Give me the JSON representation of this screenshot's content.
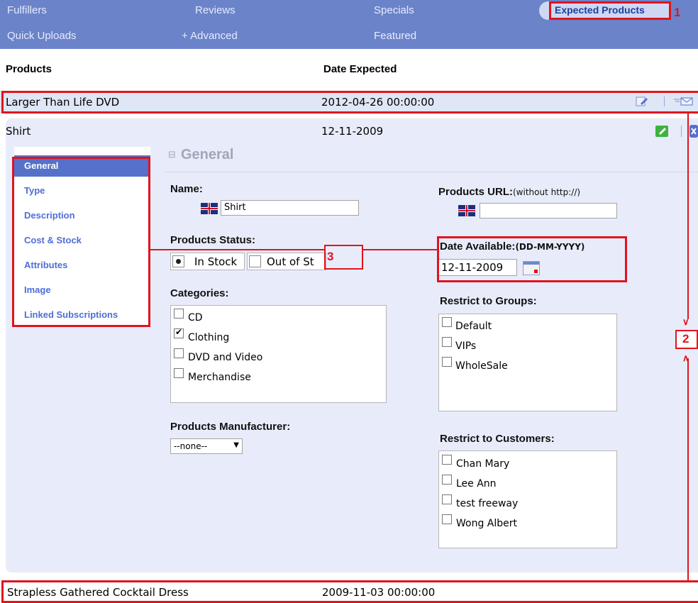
{
  "nav": {
    "row1": [
      "Fulfillers",
      "Reviews",
      "Specials"
    ],
    "row2": [
      "Quick Uploads",
      "+ Advanced",
      "Featured"
    ],
    "active_tab": "Expected Products"
  },
  "table": {
    "col_products": "Products",
    "col_date": "Date Expected",
    "rows": [
      {
        "name": "Larger Than Life DVD",
        "date": "2012-04-26 00:00:00"
      },
      {
        "name": "Shirt",
        "date": "12-11-2009"
      },
      {
        "name": "Strapless Gathered Cocktail Dress",
        "date": "2009-11-03 00:00:00"
      }
    ]
  },
  "editor": {
    "tabs": [
      "General",
      "Type",
      "Description",
      "Cost & Stock",
      "Attributes",
      "Image",
      "Linked Subscriptions"
    ],
    "section_title": "General",
    "name_label": "Name:",
    "name_value": "Shirt",
    "url_label": "Products URL:",
    "url_hint": "(without http://)",
    "url_value": "",
    "status_label": "Products Status:",
    "status_in": "In Stock",
    "status_out": "Out of St",
    "date_label": "Date Available:",
    "date_format": "(DD-MM-YYYY)",
    "date_value": "12-11-2009",
    "categories_label": "Categories:",
    "categories": [
      {
        "label": "CD",
        "checked": false
      },
      {
        "label": "Clothing",
        "checked": true
      },
      {
        "label": "DVD and Video",
        "checked": false
      },
      {
        "label": "Merchandise",
        "checked": false
      }
    ],
    "groups_label": "Restrict to Groups:",
    "groups": [
      "Default",
      "VIPs",
      "WholeSale"
    ],
    "manufacturer_label": "Products Manufacturer:",
    "manufacturer_value": "--none--",
    "customers_label": "Restrict to Customers:",
    "customers": [
      "Chan Mary",
      "Lee Ann",
      "test freeway",
      "Wong Albert"
    ]
  },
  "annotations": [
    "1",
    "2",
    "3"
  ],
  "colors": {
    "nav_bg": "#6b83c9",
    "annotation": "#e0141e",
    "panel_bg": "#e8ecfa",
    "tab_active": "#5571c9"
  }
}
